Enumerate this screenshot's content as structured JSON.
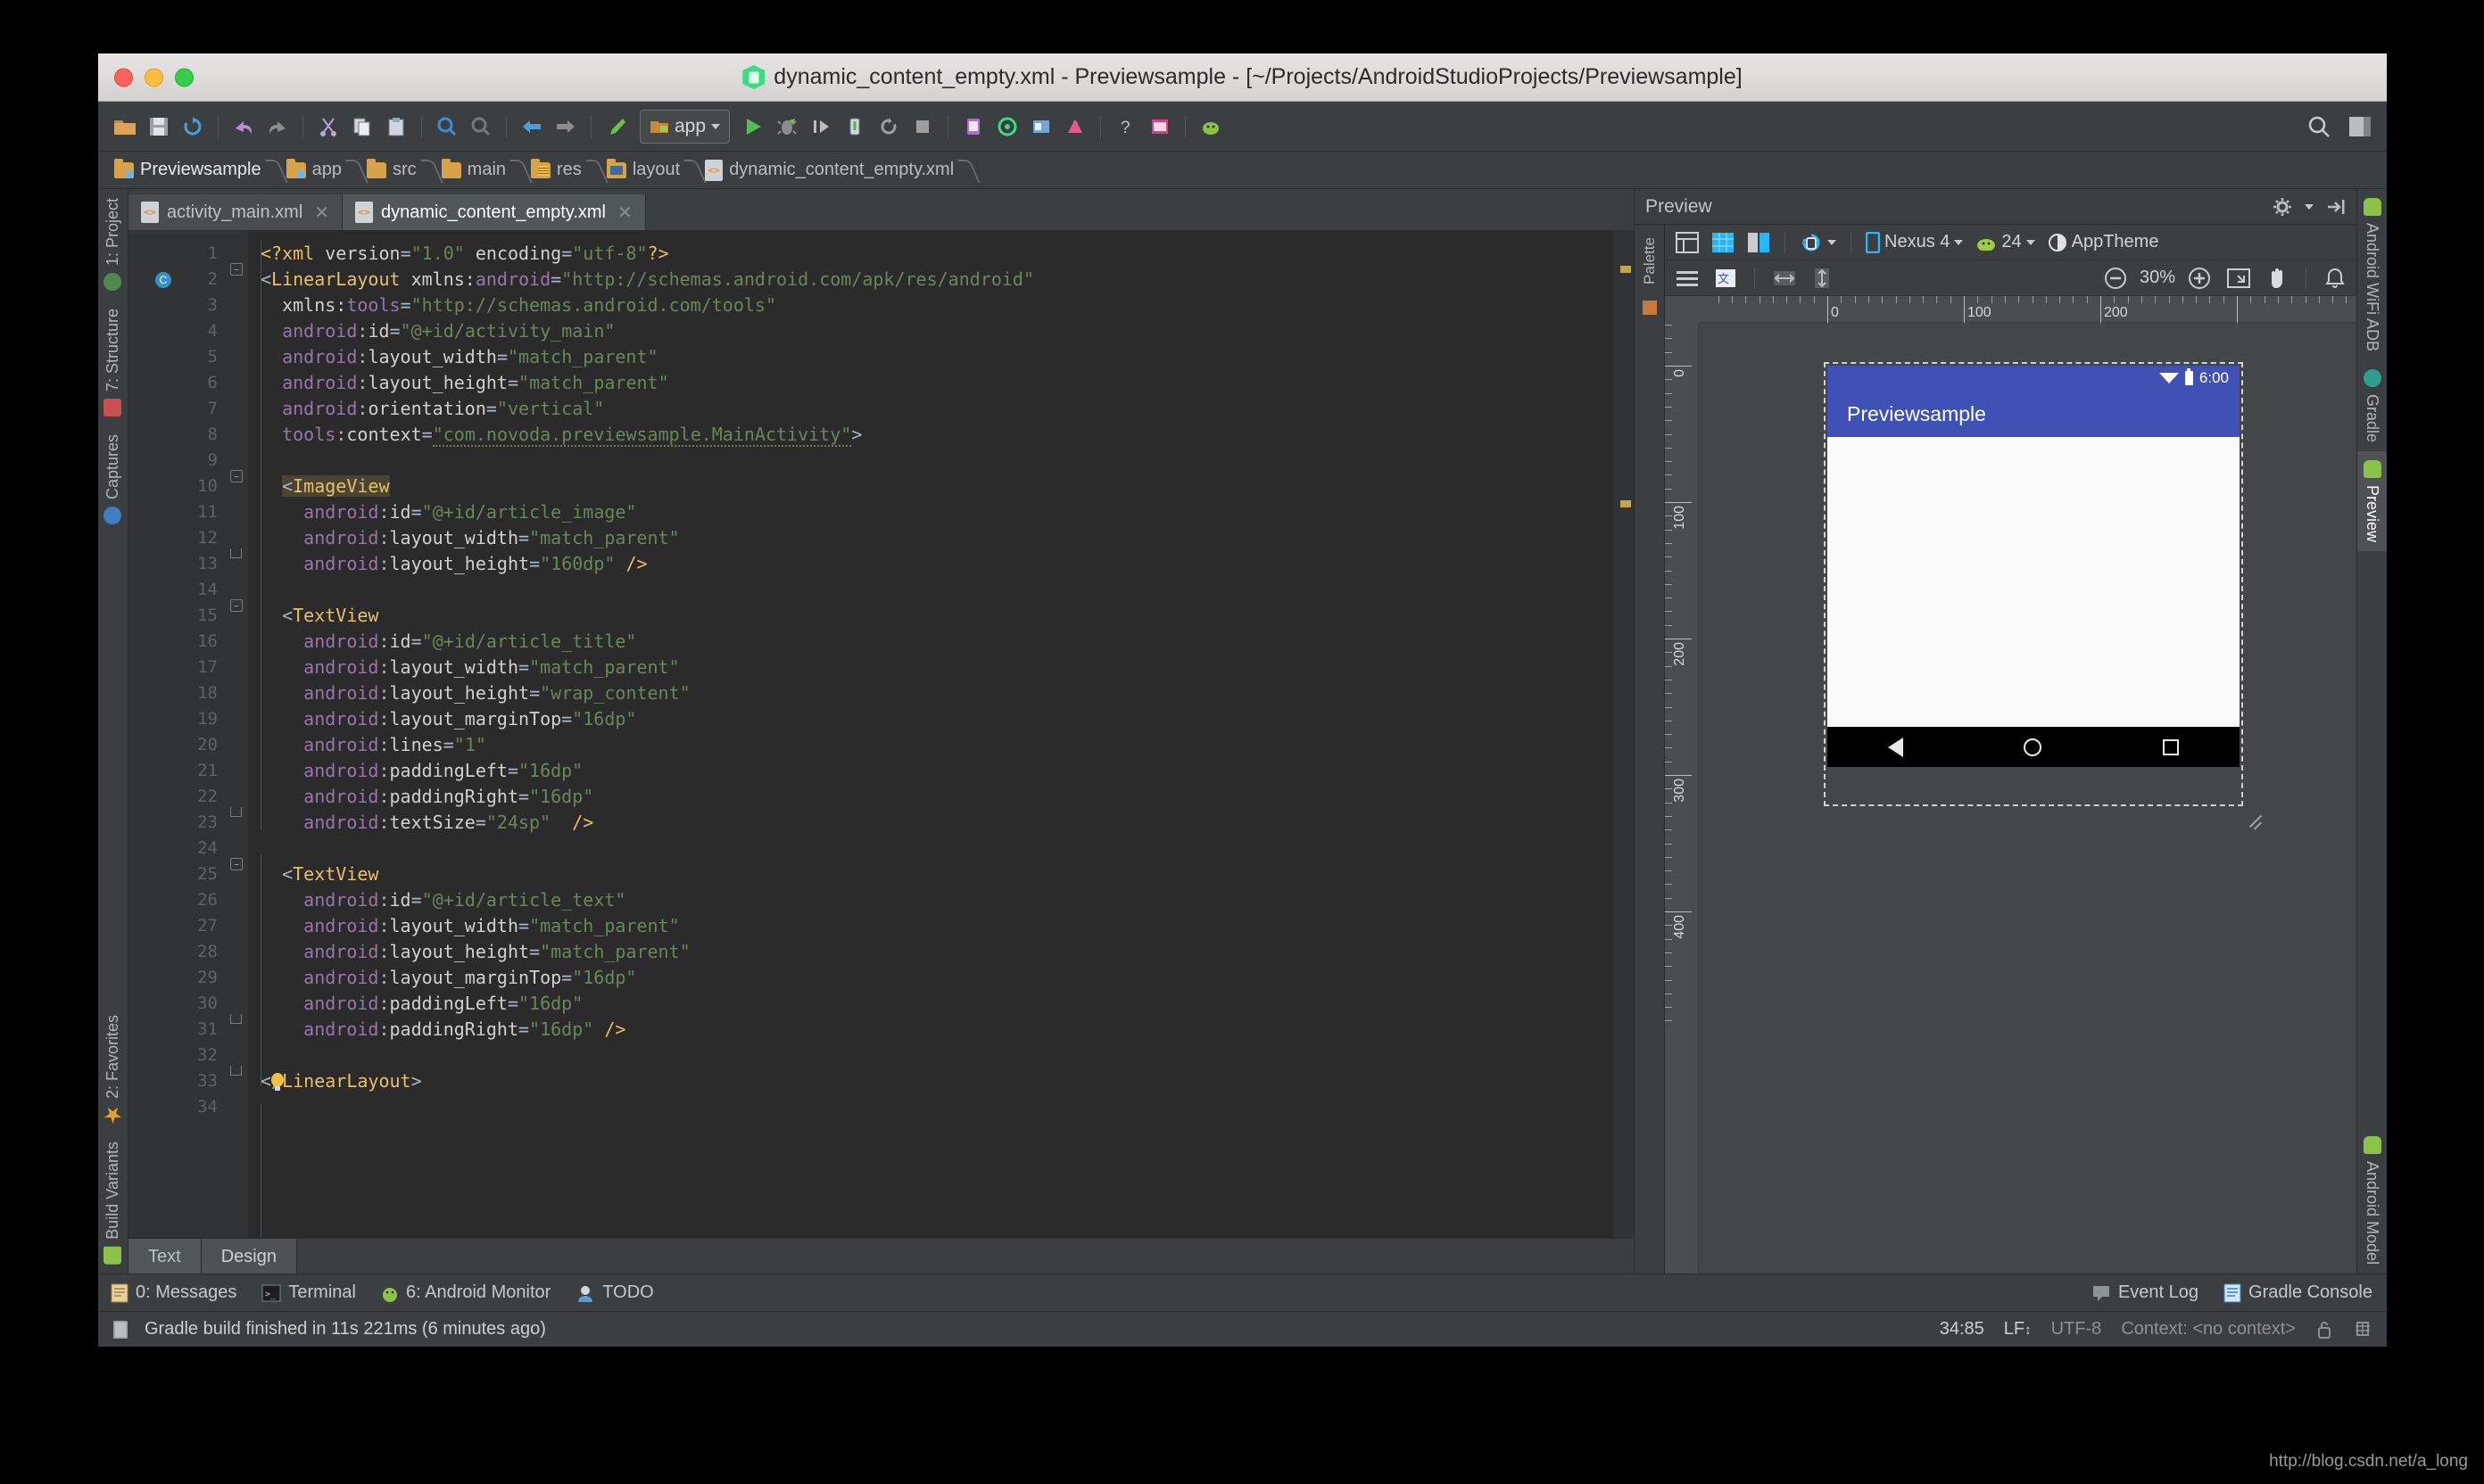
{
  "window": {
    "title": "dynamic_content_empty.xml - Previewsample - [~/Projects/AndroidStudioProjects/Previewsample]",
    "app_icon": "android-studio-icon"
  },
  "toolbar": {
    "items": [
      {
        "name": "open-folder-icon"
      },
      {
        "name": "save-all-icon"
      },
      {
        "name": "sync-icon"
      },
      {
        "name": "undo-icon"
      },
      {
        "name": "redo-icon"
      },
      {
        "name": "cut-icon"
      },
      {
        "name": "copy-icon"
      },
      {
        "name": "paste-icon"
      },
      {
        "name": "find-icon"
      },
      {
        "name": "replace-icon"
      },
      {
        "name": "back-icon"
      },
      {
        "name": "forward-icon"
      },
      {
        "name": "build-icon"
      }
    ],
    "module_selector": "app",
    "run_icon": "run-icon",
    "debug_icon": "debug-icon",
    "search_icon": "search-everywhere-icon",
    "layout_icon": "layout-icon"
  },
  "breadcrumbs": [
    {
      "label": "Previewsample",
      "icon": "module-folder-icon"
    },
    {
      "label": "app",
      "icon": "module-folder-icon"
    },
    {
      "label": "src",
      "icon": "folder-icon"
    },
    {
      "label": "main",
      "icon": "folder-icon"
    },
    {
      "label": "res",
      "icon": "res-folder-icon"
    },
    {
      "label": "layout",
      "icon": "layout-folder-icon"
    },
    {
      "label": "dynamic_content_empty.xml",
      "icon": "xml-file-icon"
    }
  ],
  "editor_tabs": [
    {
      "label": "activity_main.xml",
      "active": false
    },
    {
      "label": "dynamic_content_empty.xml",
      "active": true
    }
  ],
  "editor_footer_tabs": [
    {
      "label": "Text",
      "active": true
    },
    {
      "label": "Design",
      "active": false
    }
  ],
  "left_stripe": [
    {
      "label": "1: Project",
      "icon": "project-icon"
    },
    {
      "label": "7: Structure",
      "icon": "structure-icon"
    },
    {
      "label": "Captures",
      "icon": "captures-icon"
    },
    {
      "label": "2: Favorites",
      "icon": "favorites-star-icon"
    },
    {
      "label": "Build Variants",
      "icon": "build-variants-icon"
    }
  ],
  "right_stripe": [
    {
      "label": "Android WiFi ADB",
      "icon": "android-icon",
      "active": false
    },
    {
      "label": "Gradle",
      "icon": "gradle-icon",
      "active": false
    },
    {
      "label": "Preview",
      "icon": "preview-icon",
      "active": true
    },
    {
      "label": "Android Model",
      "icon": "android-icon",
      "active": false
    }
  ],
  "code": {
    "lines": [
      {
        "n": "1",
        "html": "<span class=\"t-proc\">&lt;?xml</span> <span class=\"t-attr2\">version</span><span class=\"t-punc\">=</span><span class=\"t-val\">\"1.0\"</span> <span class=\"t-attr2\">encoding</span><span class=\"t-punc\">=</span><span class=\"t-val\">\"utf-8\"</span><span class=\"t-proc\">?&gt;</span>"
      },
      {
        "n": "2",
        "html": "<span class=\"t-punc\">&lt;</span><span class=\"t-tag\">LinearLayout</span> <span class=\"t-attr2\">xmlns:</span><span class=\"t-ns\">android</span><span class=\"t-punc\">=</span><span class=\"t-val\">\"http://schemas.android.com/apk/res/android\"</span>"
      },
      {
        "n": "3",
        "html": "  <span class=\"t-attr2\">xmlns:</span><span class=\"t-ns\">tools</span><span class=\"t-punc\">=</span><span class=\"t-val\">\"http://schemas.android.com/tools\"</span>"
      },
      {
        "n": "4",
        "html": "  <span class=\"t-attr\">android</span><span class=\"t-punc\">:</span><span class=\"t-attr2\">id</span><span class=\"t-punc\">=</span><span class=\"t-val\">\"@+id/activity_main\"</span>"
      },
      {
        "n": "5",
        "html": "  <span class=\"t-attr\">android</span><span class=\"t-punc\">:</span><span class=\"t-attr2\">layout_width</span><span class=\"t-punc\">=</span><span class=\"t-val\">\"match_parent\"</span>"
      },
      {
        "n": "6",
        "html": "  <span class=\"t-attr\">android</span><span class=\"t-punc\">:</span><span class=\"t-attr2\">layout_height</span><span class=\"t-punc\">=</span><span class=\"t-val\">\"match_parent\"</span>"
      },
      {
        "n": "7",
        "html": "  <span class=\"t-attr\">android</span><span class=\"t-punc\">:</span><span class=\"t-attr2\">orientation</span><span class=\"t-punc\">=</span><span class=\"t-val\">\"vertical\"</span>"
      },
      {
        "n": "8",
        "html": "  <span class=\"t-attr\">tools</span><span class=\"t-punc\">:</span><span class=\"t-attr2\">context</span><span class=\"t-punc\">=</span><span class=\"t-val squiggle\">\"com.novoda.previewsample.MainActivity\"</span><span class=\"t-punc\">&gt;</span>"
      },
      {
        "n": "9",
        "html": ""
      },
      {
        "n": "10",
        "html": "  <span class=\"t-punc hl-tag\">&lt;</span><span class=\"t-tag hl-tag\">ImageView</span>"
      },
      {
        "n": "11",
        "html": "    <span class=\"t-attr\">android</span><span class=\"t-punc\">:</span><span class=\"t-attr2\">id</span><span class=\"t-punc\">=</span><span class=\"t-val\">\"@+id/article_image\"</span>"
      },
      {
        "n": "12",
        "html": "    <span class=\"t-attr\">android</span><span class=\"t-punc\">:</span><span class=\"t-attr2\">layout_width</span><span class=\"t-punc\">=</span><span class=\"t-val\">\"match_parent\"</span>"
      },
      {
        "n": "13",
        "html": "    <span class=\"t-attr\">android</span><span class=\"t-punc\">:</span><span class=\"t-attr2\">layout_height</span><span class=\"t-punc\">=</span><span class=\"t-val\">\"160dp\"</span> <span class=\"t-tag\">/&gt;</span>"
      },
      {
        "n": "14",
        "html": ""
      },
      {
        "n": "15",
        "html": "  <span class=\"t-punc\">&lt;</span><span class=\"t-tag\">TextView</span>"
      },
      {
        "n": "16",
        "html": "    <span class=\"t-attr\">android</span><span class=\"t-punc\">:</span><span class=\"t-attr2\">id</span><span class=\"t-punc\">=</span><span class=\"t-val\">\"@+id/article_title\"</span>"
      },
      {
        "n": "17",
        "html": "    <span class=\"t-attr\">android</span><span class=\"t-punc\">:</span><span class=\"t-attr2\">layout_width</span><span class=\"t-punc\">=</span><span class=\"t-val\">\"match_parent\"</span>"
      },
      {
        "n": "18",
        "html": "    <span class=\"t-attr\">android</span><span class=\"t-punc\">:</span><span class=\"t-attr2\">layout_height</span><span class=\"t-punc\">=</span><span class=\"t-val\">\"wrap_content\"</span>"
      },
      {
        "n": "19",
        "html": "    <span class=\"t-attr\">android</span><span class=\"t-punc\">:</span><span class=\"t-attr2\">layout_marginTop</span><span class=\"t-punc\">=</span><span class=\"t-val\">\"16dp\"</span>"
      },
      {
        "n": "20",
        "html": "    <span class=\"t-attr\">android</span><span class=\"t-punc\">:</span><span class=\"t-attr2\">lines</span><span class=\"t-punc\">=</span><span class=\"t-val\">\"1\"</span>"
      },
      {
        "n": "21",
        "html": "    <span class=\"t-attr\">android</span><span class=\"t-punc\">:</span><span class=\"t-attr2\">paddingLeft</span><span class=\"t-punc\">=</span><span class=\"t-val\">\"16dp\"</span>"
      },
      {
        "n": "22",
        "html": "    <span class=\"t-attr\">android</span><span class=\"t-punc\">:</span><span class=\"t-attr2\">paddingRight</span><span class=\"t-punc\">=</span><span class=\"t-val\">\"16dp\"</span>"
      },
      {
        "n": "23",
        "html": "    <span class=\"t-attr\">android</span><span class=\"t-punc\">:</span><span class=\"t-attr2\">textSize</span><span class=\"t-punc\">=</span><span class=\"t-val\">\"24sp\"</span>  <span class=\"t-tag\">/&gt;</span>"
      },
      {
        "n": "24",
        "html": ""
      },
      {
        "n": "25",
        "html": "  <span class=\"t-punc\">&lt;</span><span class=\"t-tag\">TextView</span>"
      },
      {
        "n": "26",
        "html": "    <span class=\"t-attr\">android</span><span class=\"t-punc\">:</span><span class=\"t-attr2\">id</span><span class=\"t-punc\">=</span><span class=\"t-val\">\"@+id/article_text\"</span>"
      },
      {
        "n": "27",
        "html": "    <span class=\"t-attr\">android</span><span class=\"t-punc\">:</span><span class=\"t-attr2\">layout_width</span><span class=\"t-punc\">=</span><span class=\"t-val\">\"match_parent\"</span>"
      },
      {
        "n": "28",
        "html": "    <span class=\"t-attr\">android</span><span class=\"t-punc\">:</span><span class=\"t-attr2\">layout_height</span><span class=\"t-punc\">=</span><span class=\"t-val\">\"match_parent\"</span>"
      },
      {
        "n": "29",
        "html": "    <span class=\"t-attr\">android</span><span class=\"t-punc\">:</span><span class=\"t-attr2\">layout_marginTop</span><span class=\"t-punc\">=</span><span class=\"t-val\">\"16dp\"</span>"
      },
      {
        "n": "30",
        "html": "    <span class=\"t-attr\">android</span><span class=\"t-punc\">:</span><span class=\"t-attr2\">paddingLeft</span><span class=\"t-punc\">=</span><span class=\"t-val\">\"16dp\"</span>"
      },
      {
        "n": "31",
        "html": "    <span class=\"t-attr\">android</span><span class=\"t-punc\">:</span><span class=\"t-attr2\">paddingRight</span><span class=\"t-punc\">=</span><span class=\"t-val\">\"16dp\"</span> <span class=\"t-tag\">/&gt;</span>"
      },
      {
        "n": "32",
        "html": ""
      },
      {
        "n": "33",
        "html": "<span class=\"t-punc\">&lt;/</span><span class=\"t-tag\">LinearLayout</span><span class=\"t-punc\">&gt;</span>"
      },
      {
        "n": "34",
        "html": ""
      }
    ]
  },
  "preview": {
    "title": "Preview",
    "settings_icon": "gear-icon",
    "collapse_icon": "collapse-icon",
    "palette_label": "Palette",
    "toolbar": {
      "render_mode_icon": "render-mode-icon",
      "blueprint_icon": "blueprint-icon",
      "both_modes_icon": "both-modes-icon",
      "orientation_icon": "orientation-icon",
      "device_icon": "device-icon",
      "device": "Nexus 4",
      "api_icon": "android-api-icon",
      "api_level": "24",
      "theme_icon": "theme-icon",
      "theme": "AppTheme"
    },
    "toolbar2": {
      "list_icon": "list-icon",
      "language-icon": "language-icon",
      "fit_width_icon": "fit-width-icon",
      "fit_height_icon": "fit-height-icon",
      "zoom_out_icon": "zoom-out-icon",
      "zoom_level": "30%",
      "zoom_in_icon": "zoom-in-icon",
      "zoom_fit_icon": "zoom-fit-icon",
      "pan_icon": "pan-hand-icon",
      "notification_icon": "bell-icon"
    },
    "ruler": {
      "h_labels": [
        "0",
        "100",
        "200"
      ],
      "v_labels": [
        "0",
        "100",
        "200",
        "300",
        "400"
      ]
    },
    "device_render": {
      "status_time": "6:00",
      "wifi_icon": "wifi-icon",
      "battery_icon": "battery-icon",
      "app_title": "Previewsample",
      "appbar_color": "#3f51b5",
      "content_color": "#fafafa",
      "nav_back_icon": "nav-back-icon",
      "nav_home_icon": "nav-home-icon",
      "nav_recents_icon": "nav-recents-icon"
    }
  },
  "bottom_bar": {
    "left": [
      {
        "label": "0: Messages",
        "icon": "messages-icon"
      },
      {
        "label": "Terminal",
        "icon": "terminal-icon"
      },
      {
        "label": "6: Android Monitor",
        "icon": "android-monitor-icon"
      },
      {
        "label": "TODO",
        "icon": "todo-icon"
      }
    ],
    "right": [
      {
        "label": "Event Log",
        "icon": "event-log-icon"
      },
      {
        "label": "Gradle Console",
        "icon": "gradle-console-icon"
      }
    ]
  },
  "status_line": {
    "build_icon": "build-status-icon",
    "message": "Gradle build finished in 11s 221ms (6 minutes ago)",
    "caret_position": "34:85",
    "line_separator": "LF",
    "encoding": "UTF-8",
    "context": "Context: <no context>",
    "lock_icon": "lock-icon",
    "hector_icon": "hector-icon"
  },
  "watermark": "http://blog.csdn.net/a_long"
}
